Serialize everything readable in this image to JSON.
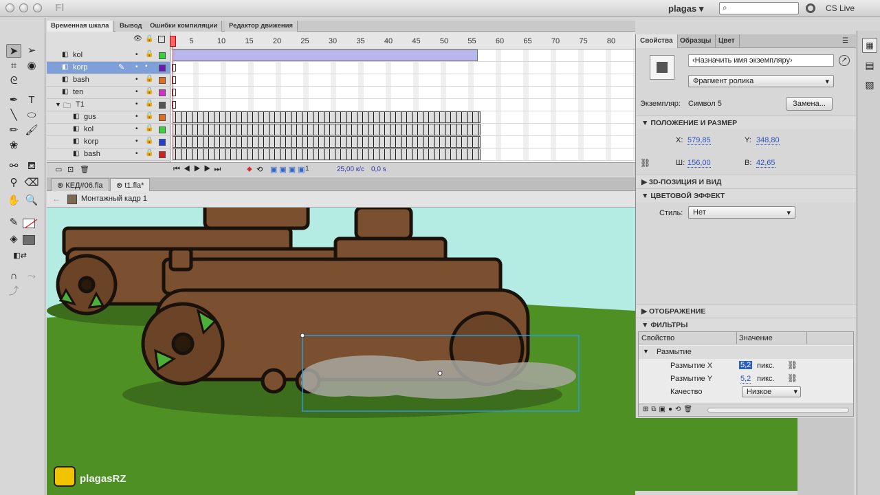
{
  "app": {
    "title_stub": "Fl",
    "workspace": "plagas",
    "cs_live": "CS Live",
    "search_placeholder": ""
  },
  "timeline": {
    "tabs": [
      "Временная шкала",
      "Вывод",
      "Ошибки компиляции",
      "Редактор движения"
    ],
    "frame_numbers": [
      "1",
      "5",
      "10",
      "15",
      "20",
      "25",
      "30",
      "35",
      "40",
      "45",
      "50",
      "55",
      "60",
      "65",
      "70",
      "75",
      "80"
    ],
    "layers": [
      {
        "name": "kol",
        "color": "#37d23a",
        "selected": false,
        "indent": 0
      },
      {
        "name": "korp",
        "color": "#6a18b8",
        "selected": true,
        "indent": 0
      },
      {
        "name": "bash",
        "color": "#e07020",
        "selected": false,
        "indent": 0
      },
      {
        "name": "ten",
        "color": "#d030c8",
        "selected": false,
        "indent": 0
      },
      {
        "name": "T1",
        "color": "#555555",
        "selected": false,
        "indent": 0,
        "folder": true
      },
      {
        "name": "gus",
        "color": "#e07020",
        "selected": false,
        "indent": 1
      },
      {
        "name": "kol",
        "color": "#37d23a",
        "selected": false,
        "indent": 1
      },
      {
        "name": "korp",
        "color": "#2040d0",
        "selected": false,
        "indent": 1
      },
      {
        "name": "bash",
        "color": "#d02020",
        "selected": false,
        "indent": 1
      }
    ],
    "fps": "25,00 к/с",
    "time": "0,0 s"
  },
  "documents": {
    "tabs": [
      "КЕД#06.fla",
      "t1.fla*"
    ],
    "breadcrumb": "Монтажный кадр 1"
  },
  "properties": {
    "tabs": [
      "Свойства",
      "Образцы",
      "Цвет"
    ],
    "instance_name_placeholder": "‹Назначить имя экземпляру›",
    "symbol_type": "Фрагмент ролика",
    "instance_label": "Экземпляр:",
    "instance_value": "Символ 5",
    "swap_button": "Замена...",
    "sections": {
      "position": "ПОЛОЖЕНИЕ И РАЗМЕР",
      "pos3d": "3D-ПОЗИЦИЯ И ВИД",
      "color_effect": "ЦВЕТОВОЙ ЭФФЕКТ",
      "display": "ОТОБРАЖЕНИЕ",
      "filters": "ФИЛЬТРЫ"
    },
    "x_label": "X:",
    "x_value": "579,85",
    "y_label": "Y:",
    "y_value": "348,80",
    "w_label": "Ш:",
    "w_value": "156,00",
    "h_label": "В:",
    "h_value": "42,65",
    "style_label": "Стиль:",
    "style_value": "Нет",
    "filters_table": {
      "col_property": "Свойство",
      "col_value": "Значение",
      "group": "Размытие",
      "rows": [
        {
          "label": "Размытие X",
          "value": "5,2",
          "unit": "пикс."
        },
        {
          "label": "Размытие Y",
          "value": "5,2",
          "unit": "пикс."
        },
        {
          "label": "Качество",
          "value": "Низкое"
        }
      ]
    }
  },
  "watermark": "plagasRZ"
}
